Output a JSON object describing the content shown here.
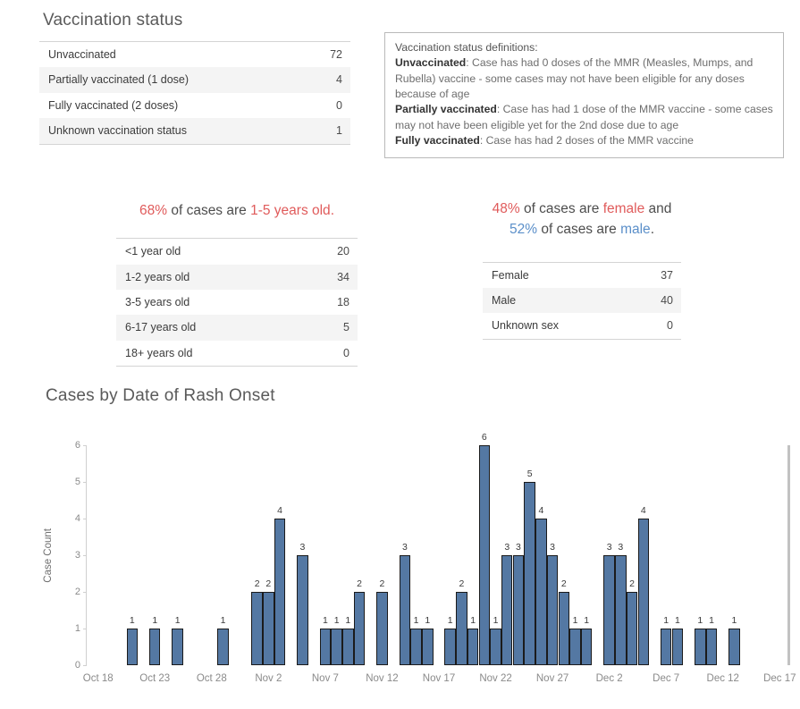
{
  "vaccination_status": {
    "title": "Vaccination status",
    "rows": [
      {
        "label": "Unvaccinated",
        "value": "72"
      },
      {
        "label": "Partially vaccinated (1 dose)",
        "value": "4"
      },
      {
        "label": "Fully vaccinated (2 doses)",
        "value": "0"
      },
      {
        "label": "Unknown vaccination status",
        "value": "1"
      }
    ]
  },
  "definitions": {
    "heading": "Vaccination status definitions:",
    "items": [
      {
        "term": "Unvaccinated",
        "text": ": Case has had 0 doses of the MMR (Measles, Mumps, and Rubella) vaccine - some cases may not have been eligible for any doses because of age"
      },
      {
        "term": "Partially vaccinated",
        "text": ": Case has had 1 dose of the MMR vaccine - some cases may not have been eligible yet for the 2nd dose due to age"
      },
      {
        "term": "Fully vaccinated",
        "text": ": Case has had 2 doses of the MMR vaccine"
      }
    ]
  },
  "age": {
    "callout": {
      "pct": "68%",
      "mid": " of cases are ",
      "group": "1-5 years old",
      "end": "."
    },
    "rows": [
      {
        "label": "<1 year old",
        "value": "20"
      },
      {
        "label": "1-2 years old",
        "value": "34"
      },
      {
        "label": "3-5 years old",
        "value": "18"
      },
      {
        "label": "6-17 years old",
        "value": "5"
      },
      {
        "label": "18+ years old",
        "value": "0"
      }
    ]
  },
  "sex": {
    "callout": {
      "pct_female": "48%",
      "mid1": " of cases are ",
      "female_word": "female",
      "and": " and",
      "pct_male": "52%",
      "mid2": " of cases are ",
      "male_word": "male",
      "end": "."
    },
    "rows": [
      {
        "label": "Female",
        "value": "37"
      },
      {
        "label": "Male",
        "value": "40"
      },
      {
        "label": "Unknown sex",
        "value": "0"
      }
    ]
  },
  "colors": {
    "bar": "#5478a3",
    "accent_red": "#e05b5b",
    "accent_blue": "#5b8fc9",
    "text_muted": "#8a8a8a"
  },
  "chart_data": {
    "type": "bar",
    "title": "Cases by Date of Rash Onset",
    "xlabel": "",
    "ylabel": "Case Count",
    "ylim": [
      0,
      6
    ],
    "yticks": [
      "0",
      "1",
      "2",
      "3",
      "4",
      "5",
      "6"
    ],
    "grid": false,
    "legend": "none",
    "xticks": [
      "Oct 18",
      "Oct 23",
      "Oct 28",
      "Nov 2",
      "Nov 7",
      "Nov 12",
      "Nov 17",
      "Nov 22",
      "Nov 27",
      "Dec 2",
      "Dec 7",
      "Dec 12",
      "Dec 17"
    ],
    "xtick_days": [
      0,
      5,
      10,
      15,
      20,
      25,
      30,
      35,
      40,
      45,
      50,
      55,
      60
    ],
    "x_domain_days": [
      -1,
      61
    ],
    "categories": [
      "Oct 21",
      "Oct 23",
      "Oct 25",
      "Oct 29",
      "Nov 1",
      "Nov 2",
      "Nov 3",
      "Nov 5",
      "Nov 7",
      "Nov 8",
      "Nov 9",
      "Nov 10",
      "Nov 12",
      "Nov 14",
      "Nov 15",
      "Nov 16",
      "Nov 18",
      "Nov 19",
      "Nov 20",
      "Nov 21",
      "Nov 22",
      "Nov 23",
      "Nov 24",
      "Nov 25",
      "Nov 26",
      "Nov 27",
      "Nov 28",
      "Nov 29",
      "Nov 30",
      "Dec 2",
      "Dec 3",
      "Dec 4",
      "Dec 5",
      "Dec 7",
      "Dec 8",
      "Dec 10",
      "Dec 11",
      "Dec 13"
    ],
    "day_offsets": [
      3,
      5,
      7,
      11,
      14,
      15,
      16,
      18,
      20,
      21,
      22,
      23,
      25,
      27,
      28,
      29,
      31,
      32,
      33,
      34,
      35,
      36,
      37,
      38,
      39,
      40,
      41,
      42,
      43,
      45,
      46,
      47,
      48,
      50,
      51,
      53,
      54,
      56
    ],
    "values": [
      1,
      1,
      1,
      1,
      2,
      2,
      4,
      3,
      1,
      1,
      1,
      2,
      2,
      3,
      1,
      1,
      1,
      2,
      1,
      6,
      1,
      3,
      3,
      5,
      4,
      3,
      2,
      1,
      1,
      3,
      3,
      2,
      4,
      1,
      1,
      1,
      1,
      1
    ]
  }
}
